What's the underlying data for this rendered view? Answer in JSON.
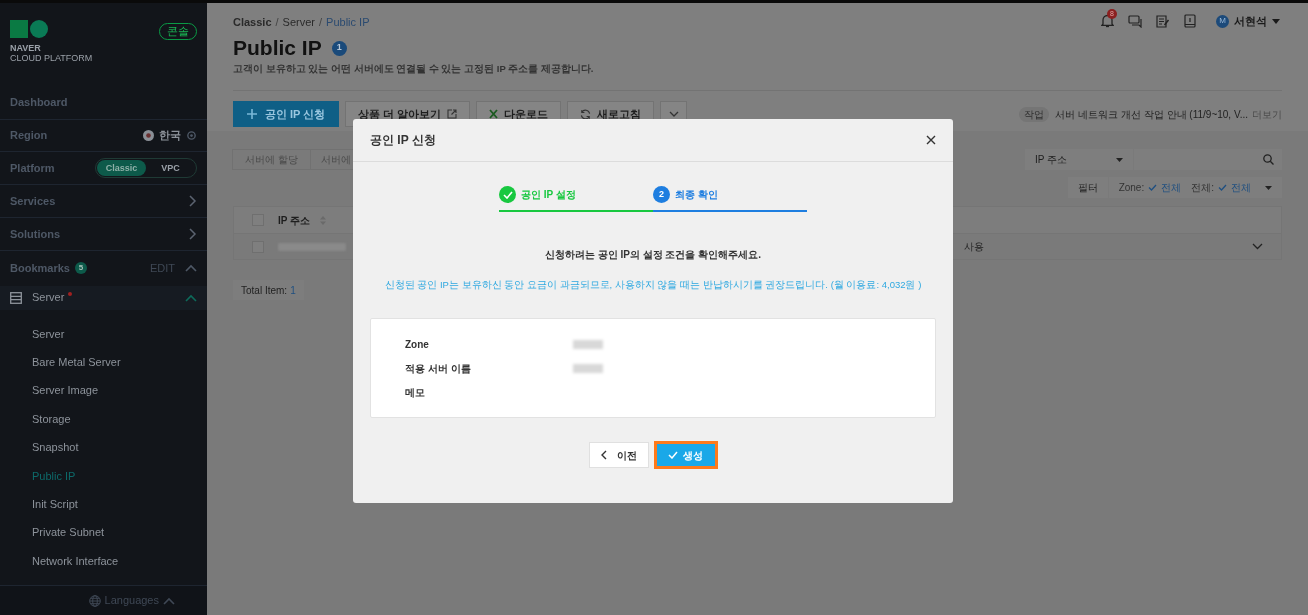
{
  "sidebar": {
    "logo": {
      "line1": "NAVER",
      "line2": "CLOUD PLATFORM"
    },
    "console_badge": "콘솔",
    "dashboard": "Dashboard",
    "region": {
      "label": "Region",
      "value": "한국"
    },
    "platform": {
      "label": "Platform",
      "options": [
        {
          "label": "Classic",
          "selected": true
        },
        {
          "label": "VPC",
          "selected": false
        }
      ]
    },
    "nav": [
      {
        "label": "Services"
      },
      {
        "label": "Solutions"
      }
    ],
    "bookmarks": {
      "label": "Bookmarks",
      "count": "5",
      "edit": "EDIT",
      "expanded": true
    },
    "group": {
      "label": "Server",
      "expanded": true,
      "children": [
        {
          "label": "Server",
          "selected": false
        },
        {
          "label": "Bare Metal Server",
          "selected": false
        },
        {
          "label": "Server Image",
          "selected": false
        },
        {
          "label": "Storage",
          "selected": false
        },
        {
          "label": "Snapshot",
          "selected": false
        },
        {
          "label": "Public IP",
          "selected": true
        },
        {
          "label": "Init Script",
          "selected": false
        },
        {
          "label": "Private Subnet",
          "selected": false
        },
        {
          "label": "Network Interface",
          "selected": false
        }
      ]
    },
    "languages": "Languages"
  },
  "top_bar": {
    "notification_count": "8",
    "user": {
      "initial": "M",
      "name": "서현석"
    }
  },
  "header": {
    "breadcrumbs": [
      "Classic",
      "Server",
      "Public IP"
    ],
    "breadcrumb_separator": "/",
    "title": "Public IP",
    "title_badge": "1",
    "description": "고객이 보유하고 있는 어떤 서버에도 연결될 수 있는 고정된 IP 주소를 제공합니다.",
    "toolbar": [
      {
        "kind": "primary",
        "label": "공인 IP 신청"
      },
      {
        "kind": "external",
        "label": "상품 더 알아보기"
      },
      {
        "kind": "excel",
        "label": "다운로드"
      },
      {
        "kind": "refresh",
        "label": "새로고침"
      },
      {
        "kind": "more"
      }
    ],
    "notice": {
      "tag": "작업",
      "text": "서버 네트워크 개선 작업 안내 (11/9~10, V...",
      "more": "더보기"
    }
  },
  "filter_tabs": [
    "서버에 할당",
    "서버에"
  ],
  "search": {
    "select": "IP 주소"
  },
  "filter": {
    "label": "필터",
    "zone_label": "Zone:",
    "zone_value": "전체",
    "type_label": "전체:",
    "type_value": "전체"
  },
  "table": {
    "all_checked": false,
    "columns": [
      "IP 주소"
    ],
    "rows": [
      {
        "status": "사용",
        "checked": false
      }
    ],
    "total_label": "Total Item:",
    "total_count": "1"
  },
  "modal": {
    "title": "공인 IP 신청",
    "steps": [
      {
        "label": "공인 IP 설정",
        "done": true,
        "selected": false
      },
      {
        "number": "2",
        "label": "최종 확인",
        "done": false,
        "selected": true
      }
    ],
    "message": "신청하려는 공인 IP의 설정 조건을 확인해주세요.",
    "note": "신청된 공인 IP는 보유하신 동안 요금이 과금되므로, 사용하지 않을 때는 반납하시기를 권장드립니다. (월 이용료: 4,032원 )",
    "fields": [
      {
        "label": "Zone",
        "redacted": true
      },
      {
        "label": "적용 서버 이름",
        "redacted": true
      },
      {
        "label": "메모",
        "redacted": false
      }
    ],
    "buttons": {
      "prev": "이전",
      "create": "생성"
    }
  }
}
